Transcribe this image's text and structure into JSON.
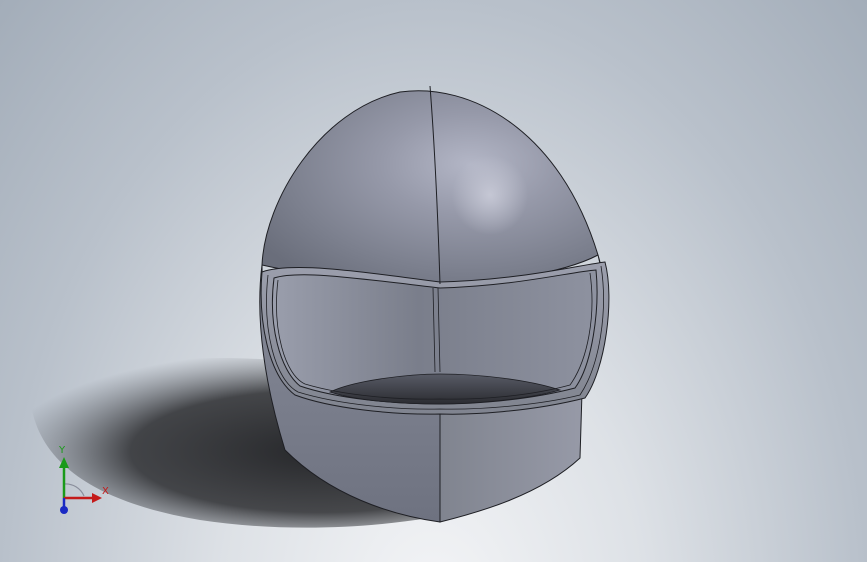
{
  "viewport": {
    "background_top": "#a3adb9",
    "background_bottom": "#f4f5f7"
  },
  "model": {
    "part": "helmet-shell",
    "shell_color": "#8a8e9c",
    "shadow_color": "#2a2b2e"
  },
  "triad": {
    "x_label": "X",
    "y_label": "Y",
    "x_color": "#c41a1a",
    "y_color": "#1a9a1a",
    "z_color": "#1a2ac4"
  }
}
